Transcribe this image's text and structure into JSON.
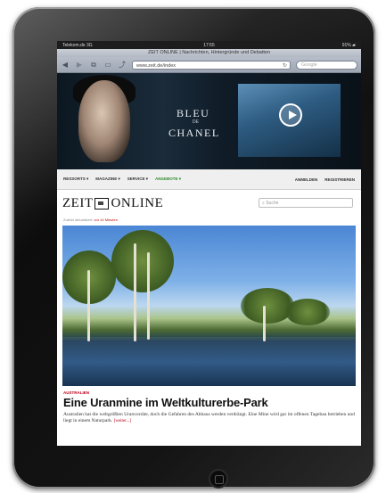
{
  "status_bar": {
    "carrier": "Telekom.de  3G",
    "time": "17:55",
    "battery": "91% ▰"
  },
  "browser": {
    "page_title": "ZEIT ONLINE | Nachrichten, Hintergründe und Debatten",
    "url": "www.zeit.de/index",
    "search_placeholder": "Google",
    "nav_icons": [
      "back-icon",
      "forward-icon",
      "pages-icon",
      "bookmarks-icon",
      "share-icon"
    ]
  },
  "ad": {
    "line1": "BLEU",
    "line2": "DE",
    "line3": "CHANEL"
  },
  "site_nav": {
    "items": [
      "RESSORTS ▾",
      "MAGAZINE ▾",
      "SERVICE ▾",
      "ANGEBOTE ▾"
    ],
    "login": "ANMELDEN",
    "register": "REGISTRIEREN"
  },
  "logo": {
    "left": "ZEIT",
    "right": "ONLINE"
  },
  "site_search_placeholder": "Suche",
  "updated": {
    "prefix": "Zuletzt aktualisiert:",
    "value": "vor 14 Minuten"
  },
  "article": {
    "kicker": "AUSTRALIEN",
    "headline": "Eine Uranmine im Weltkulturerbe-Park",
    "lead": "Australien hat die weltgrößten Uranvorräte, doch die Gefahren des Abbaus werden verdrängt. Eine Mine wird gar im offenen Tagebau betrieben und liegt in einem Naturpark.",
    "more": "[weiter...]"
  },
  "colors": {
    "accent_red": "#b8001b",
    "accent_green": "#2f8a2a"
  }
}
